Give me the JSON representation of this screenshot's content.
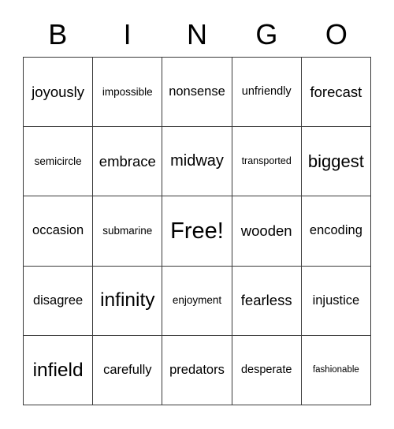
{
  "header": {
    "letters": [
      "B",
      "I",
      "N",
      "G",
      "O"
    ]
  },
  "grid": {
    "rows": 5,
    "columns": 5,
    "cells": [
      {
        "text": "joyously",
        "size": "fs-18"
      },
      {
        "text": "impossible",
        "size": "fs-13"
      },
      {
        "text": "nonsense",
        "size": "fs-16"
      },
      {
        "text": "unfriendly",
        "size": "fs-14"
      },
      {
        "text": "forecast",
        "size": "fs-18"
      },
      {
        "text": "semicircle",
        "size": "fs-13"
      },
      {
        "text": "embrace",
        "size": "fs-18"
      },
      {
        "text": "midway",
        "size": "fs-20"
      },
      {
        "text": "transported",
        "size": "fs-12"
      },
      {
        "text": "biggest",
        "size": "fs-22"
      },
      {
        "text": "occasion",
        "size": "fs-16"
      },
      {
        "text": "submarine",
        "size": "fs-13"
      },
      {
        "text": "Free!",
        "size": "fs-29"
      },
      {
        "text": "wooden",
        "size": "fs-18"
      },
      {
        "text": "encoding",
        "size": "fs-16"
      },
      {
        "text": "disagree",
        "size": "fs-16"
      },
      {
        "text": "infinity",
        "size": "fs-24"
      },
      {
        "text": "enjoyment",
        "size": "fs-13"
      },
      {
        "text": "fearless",
        "size": "fs-18"
      },
      {
        "text": "injustice",
        "size": "fs-16"
      },
      {
        "text": "infield",
        "size": "fs-24"
      },
      {
        "text": "carefully",
        "size": "fs-16"
      },
      {
        "text": "predators",
        "size": "fs-16"
      },
      {
        "text": "desperate",
        "size": "fs-14"
      },
      {
        "text": "fashionable",
        "size": "fs-11"
      }
    ]
  },
  "colors": {
    "background": "#ffffff",
    "text": "#000000",
    "border": "#3a3a3a"
  }
}
